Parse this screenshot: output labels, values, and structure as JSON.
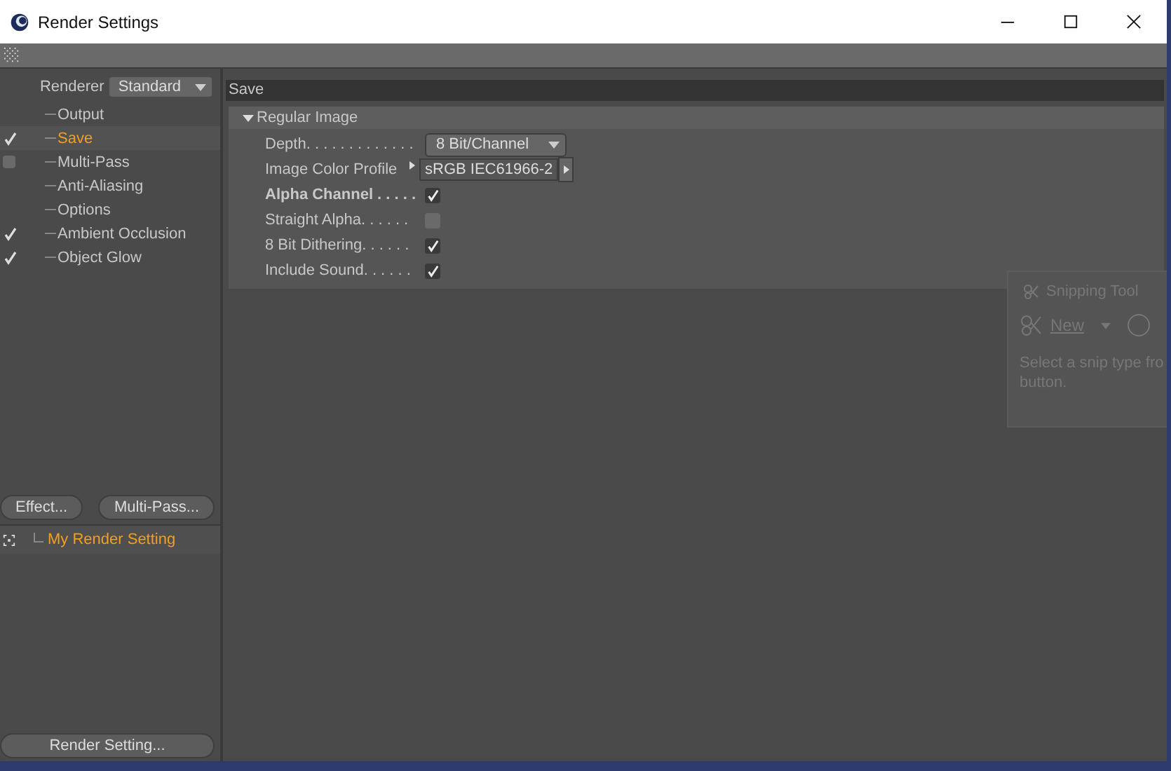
{
  "window": {
    "title": "Render Settings"
  },
  "renderer": {
    "label": "Renderer",
    "value": "Standard"
  },
  "tree": [
    {
      "label": "Output",
      "selected": false
    },
    {
      "label": "Save",
      "selected": true,
      "checked": true
    },
    {
      "label": "Multi-Pass",
      "selected": false,
      "checked": false
    },
    {
      "label": "Anti-Aliasing",
      "selected": false
    },
    {
      "label": "Options",
      "selected": false
    },
    {
      "label": "Ambient Occlusion",
      "selected": false,
      "checked": true
    },
    {
      "label": "Object Glow",
      "selected": false,
      "checked": true
    }
  ],
  "left_buttons": [
    "Effect...",
    "Multi-Pass..."
  ],
  "settings_list": [
    {
      "label": "My Render Setting",
      "selected": true
    }
  ],
  "bottom_button": "Render Setting...",
  "panel": {
    "title": "Save",
    "group": {
      "title": "Regular Image",
      "expanded": true,
      "rows": [
        {
          "kind": "dropdown",
          "label": "Depth. . . . . . . . . . . . .",
          "value": "8 Bit/Channel"
        },
        {
          "kind": "profile",
          "label": "Image Color Profile",
          "value": "sRGB IEC61966-2"
        },
        {
          "kind": "checkbox",
          "label": "Alpha Channel . . . . .",
          "emphasized": true,
          "checked": true
        },
        {
          "kind": "checkbox",
          "label": "Straight Alpha. . . . . .",
          "emphasized": false,
          "checked": false
        },
        {
          "kind": "checkbox",
          "label": "8 Bit Dithering. . . . . .",
          "emphasized": false,
          "checked": true
        },
        {
          "kind": "checkbox",
          "label": "Include Sound. . . . . .",
          "emphasized": false,
          "checked": true
        }
      ]
    }
  },
  "overlay": {
    "title": "Snipping Tool",
    "new_button": "New",
    "hint_lines": [
      "Select a snip type fro",
      "button."
    ]
  }
}
